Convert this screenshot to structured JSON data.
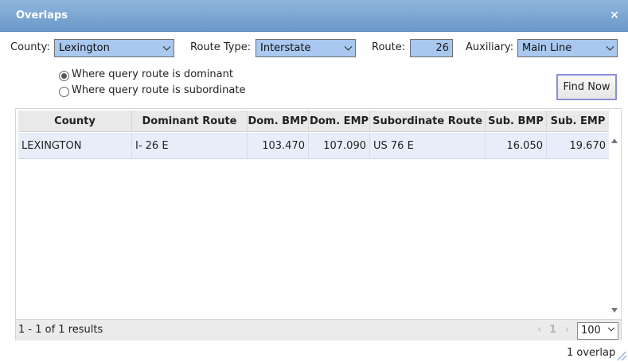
{
  "window": {
    "title": "Overlaps",
    "close_glyph": "×"
  },
  "filters": {
    "county_label": "County:",
    "county_value": "Lexington",
    "route_type_label": "Route Type:",
    "route_type_value": "Interstate",
    "route_label": "Route:",
    "route_value": "26",
    "auxiliary_label": "Auxiliary:",
    "auxiliary_value": "Main Line"
  },
  "query_mode": {
    "options": [
      {
        "label": "Where query route is dominant",
        "selected": true
      },
      {
        "label": "Where query route is subordinate",
        "selected": false
      }
    ]
  },
  "find_button": {
    "label": "Find Now"
  },
  "table": {
    "columns": [
      "County",
      "Dominant Route",
      "Dom. BMP",
      "Dom. EMP",
      "Subordinate Route",
      "Sub. BMP",
      "Sub. EMP"
    ],
    "rows": [
      [
        "LEXINGTON",
        "I- 26 E",
        "103.470",
        "107.090",
        "US 76 E",
        "16.050",
        "19.670"
      ]
    ]
  },
  "pager": {
    "results_text": "1 - 1 of 1 results",
    "prev_glyph": "‹",
    "current_page": "1",
    "next_glyph": "›",
    "page_size": "100"
  },
  "footer": {
    "count_text": "1 overlap"
  },
  "icons": {
    "close": "close-icon",
    "resize": "resize-grip-icon"
  },
  "colors": {
    "titlebar": "#7aa5d4",
    "field_bg": "#a9c8ef",
    "selected_row": "#e8eef9"
  }
}
